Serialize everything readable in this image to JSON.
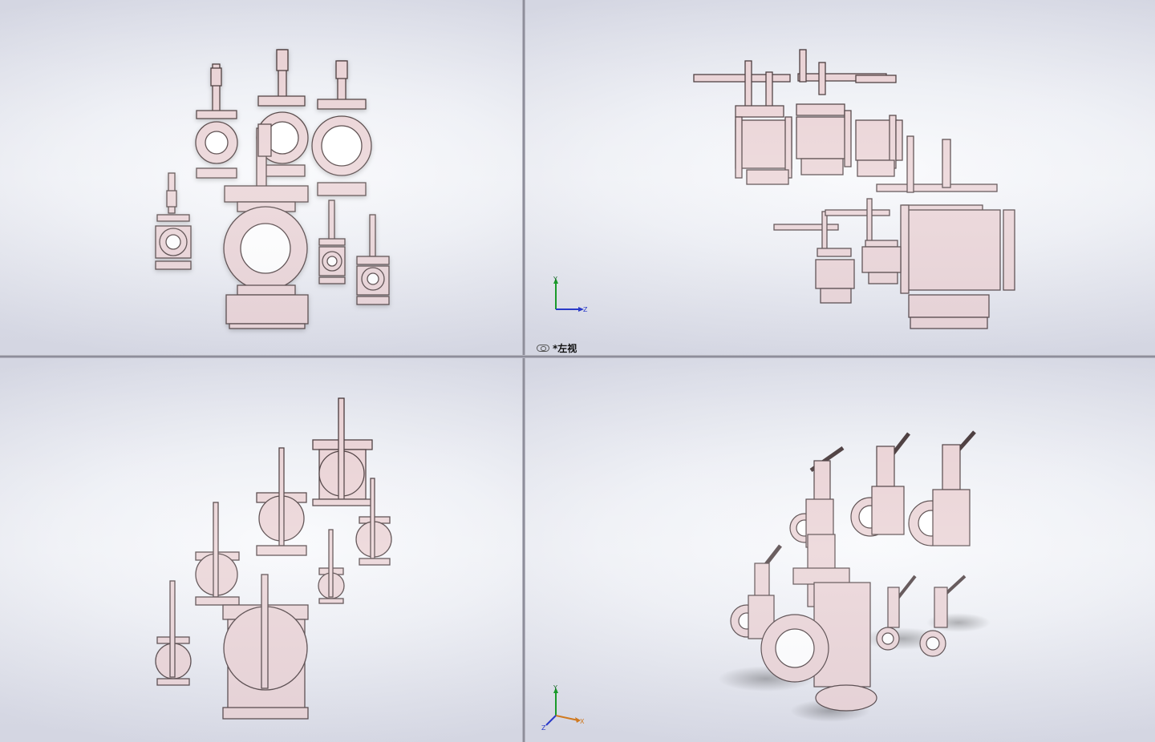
{
  "viewports": {
    "front": {
      "name": "front-view"
    },
    "left": {
      "name": "left-view",
      "label": "*左视"
    },
    "top": {
      "name": "top-view"
    },
    "iso": {
      "name": "isometric-view"
    }
  },
  "triad_axes": {
    "y": "Y",
    "z": "Z",
    "x": "X"
  },
  "colors": {
    "part_fill": "#e8cfd2",
    "part_stroke": "#3a2a2c",
    "axis_y": "#1a9a2a",
    "axis_z": "#2a3ac8",
    "axis_x": "#d07a20"
  }
}
